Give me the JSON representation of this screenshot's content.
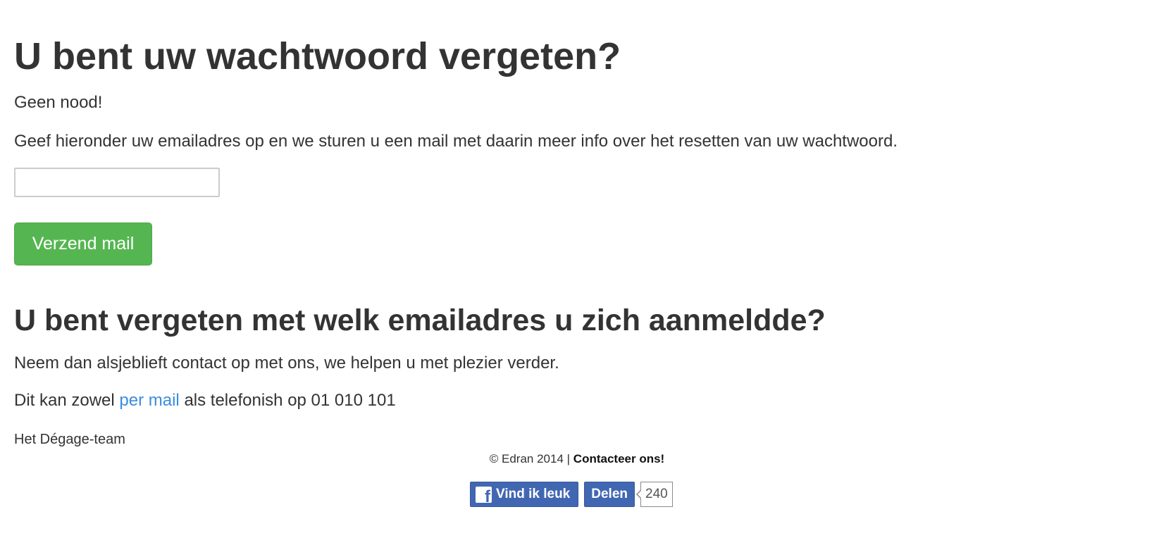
{
  "forgot_password": {
    "title": "U bent uw wachtwoord vergeten?",
    "subtitle": "Geen nood!",
    "instructions": "Geef hieronder uw emailadres op en we sturen u een mail met daarin meer info over het resetten van uw wachtwoord.",
    "email_value": "",
    "send_button_label": "Verzend mail"
  },
  "forgot_email": {
    "title": "U bent vergeten met welk emailadres u zich aanmeldde?",
    "contact_text": "Neem dan alsjeblieft contact op met ons, we helpen u met plezier verder.",
    "contact_prefix": "Dit kan zowel",
    "contact_link": "per mail",
    "contact_suffix": "als telefonish op 01 010 101",
    "signature": "Het Dégage-team"
  },
  "footer": {
    "copyright": "© Edran 2014 |",
    "contact_link": "Contacteer ons!"
  },
  "social": {
    "like_label": "Vind ik leuk",
    "share_label": "Delen",
    "share_count": "240",
    "icon": "facebook-icon",
    "color": "#4267b2"
  },
  "colors": {
    "button_green": "#55b651",
    "link_blue": "#3a8dde",
    "text": "#333333"
  }
}
